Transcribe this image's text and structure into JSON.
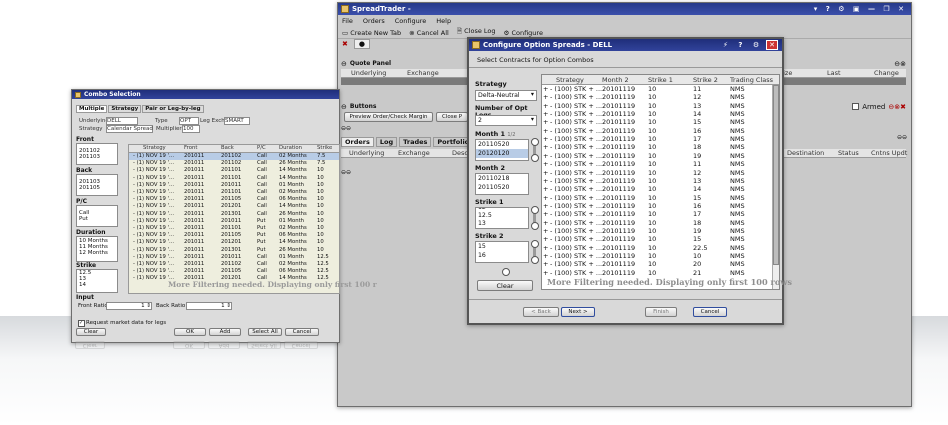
{
  "spreadtrader": {
    "title": "SpreadTrader -",
    "menu": [
      "File",
      "Orders",
      "Configure",
      "Help"
    ],
    "toolbar": [
      "Create New Tab",
      "Cancel All",
      "Close Log",
      "Configure"
    ],
    "quote_panel": {
      "title": "Quote Panel",
      "cols": [
        "Underlying",
        "Exchange",
        "Size",
        "Last",
        "Change"
      ]
    },
    "buttons_panel": {
      "title": "Buttons",
      "preview": "Preview Order/Check Margin",
      "close": "Close P",
      "armed": "Armed"
    },
    "tabs": [
      "Orders",
      "Log",
      "Trades",
      "Portfolio"
    ],
    "orders_cols": [
      "Underlying",
      "Exchange",
      "Desc",
      "Destination",
      "Status",
      "Cntns Updt"
    ]
  },
  "configure": {
    "title": "Configure Option Spreads - DELL",
    "subtitle": "Select Contracts for Option Combos",
    "strategy_label": "Strategy",
    "strategy_value": "Delta-Neutral",
    "numlegs_label": "Number of Opt Legs",
    "numlegs_value": "2",
    "month1_label": "Month 1",
    "month1_count": "1/2",
    "month1_items": [
      "20110520",
      "20120120"
    ],
    "month2_label": "Month 2",
    "month2_items": [
      "20110218",
      "20110520"
    ],
    "strike1_label": "Strike 1",
    "strike1_items": [
      "12",
      "12.5",
      "13"
    ],
    "strike2_label": "Strike 2",
    "strike2_items": [
      "15",
      "16"
    ],
    "clear": "Clear",
    "columns": [
      "Strategy",
      "Month 2",
      "Strike 1",
      "Strike 2",
      "Trading Class"
    ],
    "rows": [
      [
        "- (100) STK + ...",
        "20101119",
        "10",
        "11",
        "NMS"
      ],
      [
        "- (100) STK + ...",
        "20101119",
        "10",
        "12",
        "NMS"
      ],
      [
        "- (100) STK + ...",
        "20101119",
        "10",
        "13",
        "NMS"
      ],
      [
        "- (100) STK + ...",
        "20101119",
        "10",
        "14",
        "NMS"
      ],
      [
        "- (100) STK + ...",
        "20101119",
        "10",
        "15",
        "NMS"
      ],
      [
        "- (100) STK + ...",
        "20101119",
        "10",
        "16",
        "NMS"
      ],
      [
        "- (100) STK + ...",
        "20101119",
        "10",
        "17",
        "NMS"
      ],
      [
        "- (100) STK + ...",
        "20101119",
        "10",
        "18",
        "NMS"
      ],
      [
        "- (100) STK + ...",
        "20101119",
        "10",
        "19",
        "NMS"
      ],
      [
        "- (100) STK + ...",
        "20101119",
        "10",
        "11",
        "NMS"
      ],
      [
        "- (100) STK + ...",
        "20101119",
        "10",
        "12",
        "NMS"
      ],
      [
        "- (100) STK + ...",
        "20101119",
        "10",
        "13",
        "NMS"
      ],
      [
        "- (100) STK + ...",
        "20101119",
        "10",
        "14",
        "NMS"
      ],
      [
        "- (100) STK + ...",
        "20101119",
        "10",
        "15",
        "NMS"
      ],
      [
        "- (100) STK + ...",
        "20101119",
        "10",
        "16",
        "NMS"
      ],
      [
        "- (100) STK + ...",
        "20101119",
        "10",
        "17",
        "NMS"
      ],
      [
        "- (100) STK + ...",
        "20101119",
        "10",
        "18",
        "NMS"
      ],
      [
        "- (100) STK + ...",
        "20101119",
        "10",
        "19",
        "NMS"
      ],
      [
        "- (100) STK + ...",
        "20101119",
        "10",
        "15",
        "NMS"
      ],
      [
        "- (100) STK + ...",
        "20101119",
        "10",
        "22.5",
        "NMS"
      ],
      [
        "- (100) STK + ...",
        "20101119",
        "10",
        "10",
        "NMS"
      ],
      [
        "- (100) STK + ...",
        "20101119",
        "10",
        "20",
        "NMS"
      ],
      [
        "- (100) STK + ...",
        "20101119",
        "10",
        "21",
        "NMS"
      ]
    ],
    "message": "More Filtering needed. Displaying only first 100 rows",
    "back": "< Back",
    "next": "Next >",
    "finish": "Finish",
    "cancel": "Cancel"
  },
  "combo": {
    "title": "Combo Selection",
    "tabs": [
      "Multiple",
      "Strategy",
      "Pair or Leg-by-leg"
    ],
    "underlying_label": "Underlying",
    "underlying_value": "DELL",
    "type_label": "Type",
    "type_value": "OPT",
    "legexch_label": "Leg Exch",
    "legexch_value": "SMART",
    "strategy_label": "Strategy",
    "strategy_value": "Calendar Spread",
    "multiplier_label": "Multiplier",
    "multiplier_value": "100",
    "filters": [
      {
        "label": "Front",
        "items": [
          "201102",
          "201103"
        ]
      },
      {
        "label": "Back",
        "items": [
          "201103",
          "201105"
        ]
      },
      {
        "label": "P/C",
        "items": [
          "Call",
          "Put"
        ]
      },
      {
        "label": "Duration",
        "items": [
          "10 Months",
          "11 Months",
          "12 Months"
        ]
      },
      {
        "label": "Strike",
        "items": [
          "12.5",
          "13",
          "14"
        ]
      }
    ],
    "columns": [
      "Strategy",
      "Front",
      "Back",
      "P/C",
      "Duration",
      "Strike"
    ],
    "rows": [
      [
        "- (1) NOV 19 '...",
        "201011",
        "201102",
        "Call",
        "02 Months",
        "7.5"
      ],
      [
        "- (1) NOV 19 '...",
        "201011",
        "201102",
        "Call",
        "26 Months",
        "7.5"
      ],
      [
        "- (1) NOV 19 '...",
        "201011",
        "201101",
        "Call",
        "14 Months",
        "10"
      ],
      [
        "- (1) NOV 19 '...",
        "201011",
        "201101",
        "Call",
        "14 Months",
        "10"
      ],
      [
        "- (1) NOV 19 '...",
        "201011",
        "201011",
        "Call",
        "01 Month",
        "10"
      ],
      [
        "- (1) NOV 19 '...",
        "201011",
        "201101",
        "Call",
        "02 Months",
        "10"
      ],
      [
        "- (1) NOV 19 '...",
        "201011",
        "201105",
        "Call",
        "06 Months",
        "10"
      ],
      [
        "- (1) NOV 19 '...",
        "201011",
        "201201",
        "Call",
        "14 Months",
        "10"
      ],
      [
        "- (1) NOV 19 '...",
        "201011",
        "201301",
        "Call",
        "26 Months",
        "10"
      ],
      [
        "- (1) NOV 19 '...",
        "201011",
        "201011",
        "Put",
        "01 Month",
        "10"
      ],
      [
        "- (1) NOV 19 '...",
        "201011",
        "201101",
        "Put",
        "02 Months",
        "10"
      ],
      [
        "- (1) NOV 19 '...",
        "201011",
        "201105",
        "Put",
        "06 Months",
        "10"
      ],
      [
        "- (1) NOV 19 '...",
        "201011",
        "201201",
        "Put",
        "14 Months",
        "10"
      ],
      [
        "- (1) NOV 19 '...",
        "201011",
        "201301",
        "Put",
        "26 Months",
        "10"
      ],
      [
        "- (1) NOV 19 '...",
        "201011",
        "201011",
        "Call",
        "01 Month",
        "12.5"
      ],
      [
        "- (1) NOV 19 '...",
        "201011",
        "201102",
        "Call",
        "02 Months",
        "12.5"
      ],
      [
        "- (1) NOV 19 '...",
        "201011",
        "201105",
        "Call",
        "06 Months",
        "12.5"
      ],
      [
        "- (1) NOV 19 '...",
        "201011",
        "201201",
        "Call",
        "14 Months",
        "12.5"
      ]
    ],
    "message": "More Filtering needed. Displaying only first 100 r",
    "input_label": "Input",
    "front_ratio_label": "Front Ratio",
    "front_ratio_value": "1",
    "back_ratio_label": "Back Ratio",
    "back_ratio_value": "1",
    "request_label": "Request market data for legs",
    "clear": "Clear",
    "ok": "OK",
    "add": "Add",
    "select_all": "Select All",
    "cancel": "Cancel"
  }
}
